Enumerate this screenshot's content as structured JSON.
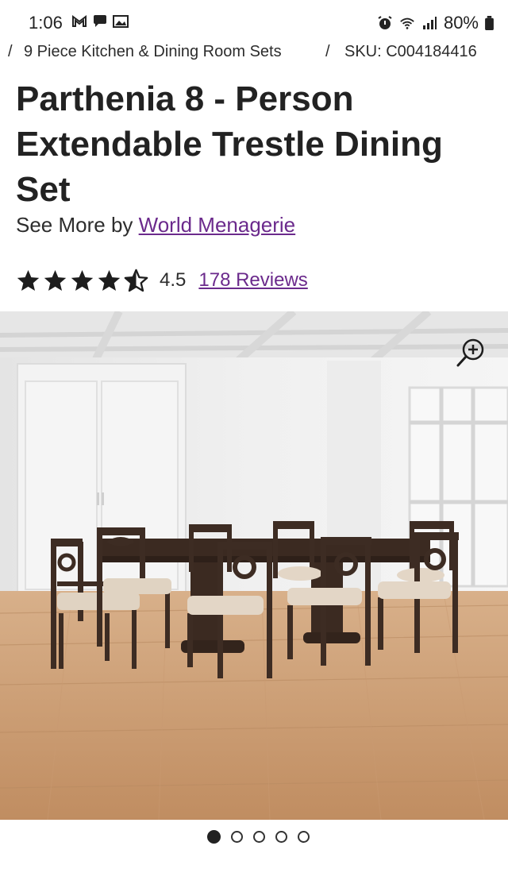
{
  "status_bar": {
    "time": "1:06",
    "battery": "80%",
    "icons": [
      "gmail-icon",
      "chat-icon",
      "photo-icon",
      "alarm-icon",
      "wifi-icon",
      "signal-icon",
      "battery-icon"
    ]
  },
  "breadcrumb": {
    "separator_left": "/",
    "category": "9 Piece Kitchen & Dining Room Sets",
    "separator": "/",
    "sku": "SKU: C004184416"
  },
  "product": {
    "title_line1": "Parthenia 8 - Person",
    "title_line2": "Extendable Trestle Dining",
    "title_line3": "Set",
    "see_more_prefix": "See More by",
    "brand": "World Menagerie",
    "rating": "4.5",
    "reviews": "178 Reviews",
    "stars_filled": 4.5,
    "stars_total": 5
  },
  "gallery": {
    "image_count": 5,
    "active_index": 0,
    "zoom_icon": "zoom-in-icon"
  },
  "colors": {
    "link": "#6b2a8c",
    "text": "#222222",
    "floor": "#c99a6e",
    "wood": "#3f2d24"
  }
}
